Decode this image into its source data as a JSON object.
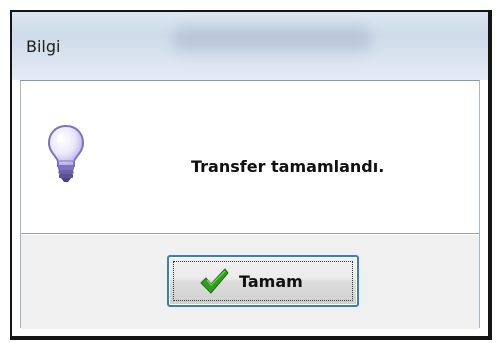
{
  "window": {
    "title": "Bilgi"
  },
  "dialog": {
    "icon": "lightbulb-icon",
    "message": "Transfer tamamlandı.",
    "ok_button": {
      "label": "Tamam",
      "icon": "checkmark-icon"
    }
  },
  "colors": {
    "titlebar": "#d5e0ed",
    "button_border_focus": "#3c7fb1",
    "checkmark": "#2f9e1d",
    "bulb_glass": "#dcd6f7",
    "bulb_base": "#6a5fa8"
  }
}
